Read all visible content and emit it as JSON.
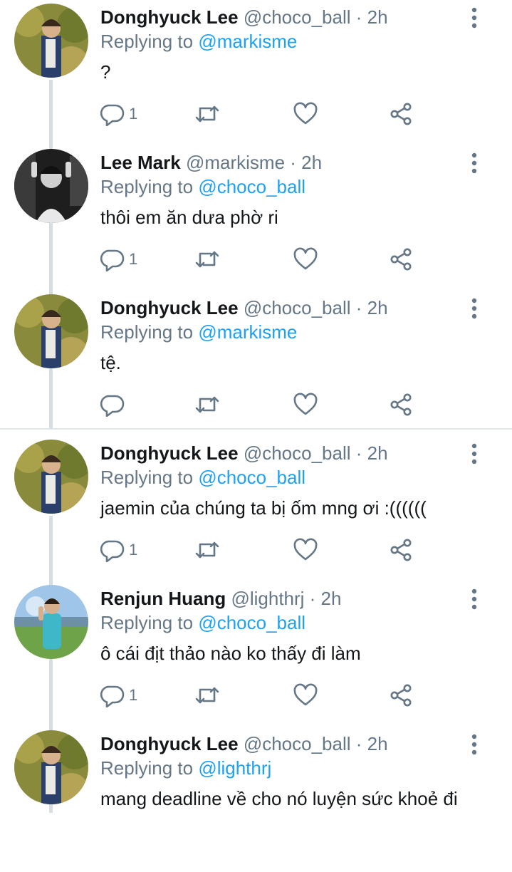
{
  "colors": {
    "link": "#1da1f2",
    "secondary": "#657786",
    "text": "#14171a",
    "thread_line": "#d8dde2"
  },
  "tweets": [
    {
      "name": "Donghyuck Lee",
      "handle": "@choco_ball",
      "time": "2h",
      "replying_label": "Replying to",
      "replying_to": "@markisme",
      "text": "?",
      "reply_count": "1",
      "avatar": "avatar-donghyuck"
    },
    {
      "name": "Lee Mark",
      "handle": "@markisme",
      "time": "2h",
      "replying_label": "Replying to",
      "replying_to": "@choco_ball",
      "text": "thôi em ăn dưa phờ ri",
      "reply_count": "1",
      "avatar": "avatar-mark"
    },
    {
      "name": "Donghyuck Lee",
      "handle": "@choco_ball",
      "time": "2h",
      "replying_label": "Replying to",
      "replying_to": "@markisme",
      "text": "tệ.",
      "reply_count": "",
      "avatar": "avatar-donghyuck"
    },
    {
      "name": "Donghyuck Lee",
      "handle": "@choco_ball",
      "time": "2h",
      "replying_label": "Replying to",
      "replying_to": "@choco_ball",
      "text": "jaemin của chúng ta bị ốm mng ơi :((((((",
      "reply_count": "1",
      "avatar": "avatar-donghyuck"
    },
    {
      "name": "Renjun Huang",
      "handle": "@lighthrj",
      "time": "2h",
      "replying_label": "Replying to",
      "replying_to": "@choco_ball",
      "text": "ô cái địt thảo nào ko thấy đi làm",
      "reply_count": "1",
      "avatar": "avatar-renjun"
    },
    {
      "name": "Donghyuck Lee",
      "handle": "@choco_ball",
      "time": "2h",
      "replying_label": "Replying to",
      "replying_to": "@lighthrj",
      "text": "mang deadline về cho nó luyện sức khoẻ đi",
      "reply_count": "",
      "avatar": "avatar-donghyuck"
    }
  ]
}
